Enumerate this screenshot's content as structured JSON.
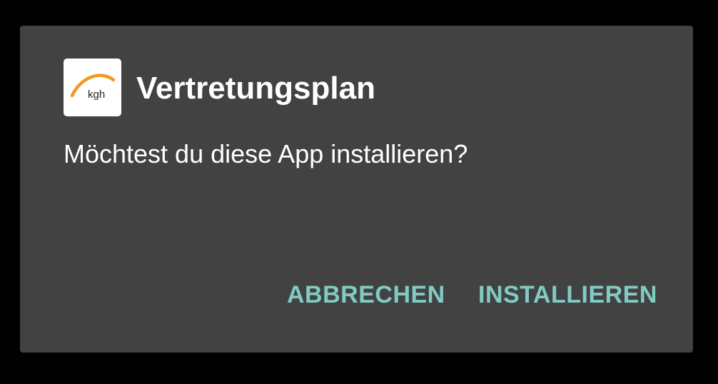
{
  "dialog": {
    "app_name": "Vertretungsplan",
    "message": "Möchtest du diese App installieren?",
    "icon": {
      "name": "kgh-logo-icon",
      "text": "kgh",
      "arc_color": "#f39a1e"
    },
    "buttons": {
      "cancel_label": "ABBRECHEN",
      "install_label": "INSTALLIEREN"
    },
    "colors": {
      "background": "#424242",
      "accent": "#80cbc4"
    }
  }
}
